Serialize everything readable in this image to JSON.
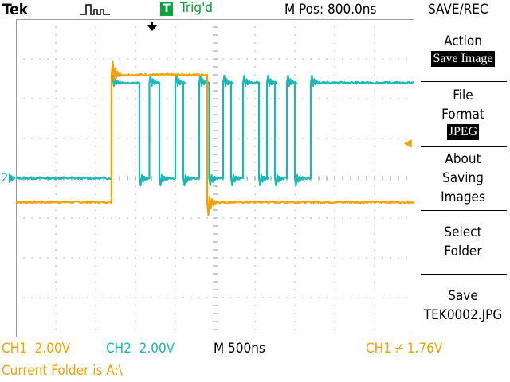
{
  "header": {
    "brand": "Tek",
    "trigger_badge": "T",
    "trigger_status": "Trig'd",
    "m_pos": "M Pos: 800.0ns",
    "menu_title": "SAVE/REC"
  },
  "side_menu": [
    {
      "label": "Action",
      "value": "Save Image",
      "value_selected": true
    },
    {
      "label": "File\nFormat",
      "value": "JPEG",
      "value_selected": true
    },
    {
      "label": "About\nSaving\nImages",
      "value": "",
      "value_selected": false
    },
    {
      "label": "Select\nFolder",
      "value": "",
      "value_selected": false
    },
    {
      "label": "Save",
      "value": "TEK0002.JPG",
      "value_selected": false
    }
  ],
  "status_bar": {
    "ch1": "CH1  2.00V",
    "ch2": "CH2  2.00V",
    "timebase": "M 500ns",
    "trigger": "CH1 ⌿ 1.76V",
    "folder": "Current Folder is A:\\"
  },
  "markers": {
    "ch2_ground": "2",
    "ch1_ground": "",
    "trigger_level_arrow": "◀"
  },
  "colors": {
    "ch1": "#f5a000",
    "ch2": "#1ab8b8",
    "grid": "#9a9a9a",
    "trigger_badge": "#08a63a"
  },
  "chart_data": {
    "type": "line",
    "x_unit": "div",
    "y_unit": "div",
    "xlim": [
      0,
      10
    ],
    "ylim": [
      -4,
      4
    ],
    "grid_divisions": {
      "x": 10,
      "y": 8
    },
    "series": [
      {
        "name": "CH1",
        "high": 2.6,
        "low": -0.6,
        "edges": [
          2.4,
          4.8
        ]
      },
      {
        "name": "CH2",
        "high": 2.4,
        "low": 0.0,
        "edges": [
          2.4,
          3.1,
          3.35,
          3.6,
          4.0,
          4.2,
          4.6,
          4.85,
          5.2,
          5.4,
          5.7,
          6.1,
          6.3,
          6.5,
          6.8,
          7.0,
          7.4
        ]
      }
    ]
  }
}
